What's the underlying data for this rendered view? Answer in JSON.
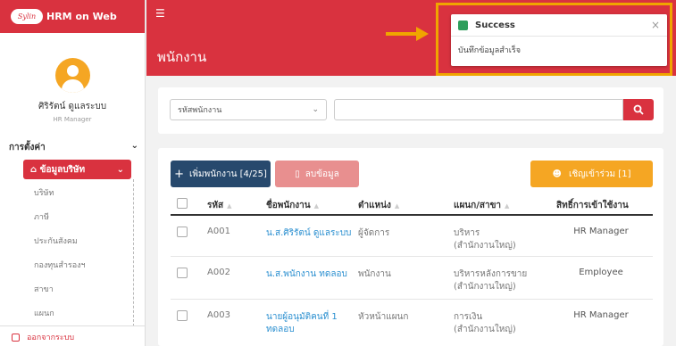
{
  "brand": {
    "logo_text": "Sylin",
    "app_name": "HRM on Web"
  },
  "user": {
    "name": "ศิริรัตน์ ดูแลระบบ",
    "role": "HR Manager"
  },
  "menu": {
    "settings_label": "การตั้งค่า",
    "company_section": "ข้อมูลบริษัท",
    "sub_items": [
      "บริษัท",
      "ภาษี",
      "ประกันสังคม",
      "กองทุนสำรองฯ",
      "สาขา",
      "แผนก"
    ],
    "logout": "ออกจากระบบ"
  },
  "header": {
    "page_title": "พนักงาน"
  },
  "toast": {
    "title": "Success",
    "message": "บันทึกข้อมูลสำเร็จ",
    "close": "×"
  },
  "search": {
    "select_value": "รหัสพนักงาน",
    "input_value": ""
  },
  "actions": {
    "add_label": "เพิ่มพนักงาน [4/25]",
    "delete_label": "ลบข้อมูล",
    "invite_label": "เชิญเข้าร่วม [1]"
  },
  "table": {
    "headers": {
      "code": "รหัส",
      "name": "ชื่อพนักงาน",
      "position": "ตำแหน่ง",
      "dept": "แผนก/สาขา",
      "rights": "สิทธิ์การเข้าใช้งาน"
    },
    "rows": [
      {
        "code": "A001",
        "name": [
          "น.ส.ศิริรัตน์ ดูแลระบบ"
        ],
        "position": "ผู้จัดการ",
        "dept": [
          "บริหาร",
          "(สำนักงานใหญ่)"
        ],
        "rights": "HR Manager"
      },
      {
        "code": "A002",
        "name": [
          "น.ส.พนักงาน ทดลอบ"
        ],
        "position": "พนักงาน",
        "dept": [
          "บริหารหลังการขาย",
          "(สำนักงานใหญ่)"
        ],
        "rights": "Employee"
      },
      {
        "code": "A003",
        "name": [
          "นายผู้อนุมัติคนที่ 1",
          "ทดลอบ"
        ],
        "position": "หัวหน้าแผนก",
        "dept": [
          "การเงิน",
          "(สำนักงานใหญ่)"
        ],
        "rights": "HR Manager"
      }
    ]
  },
  "colors": {
    "brand_red": "#d9323f",
    "navy": "#27496d",
    "orange": "#f5a623",
    "success_green": "#2e9e5b",
    "link_blue": "#2a8fd0"
  },
  "icons": [
    "menu-icon",
    "avatar-icon",
    "chevron-down-icon",
    "home-icon",
    "logout-icon",
    "success-icon",
    "close-icon",
    "arrow-icon",
    "search-icon",
    "plus-icon",
    "trash-icon",
    "user-icon"
  ]
}
